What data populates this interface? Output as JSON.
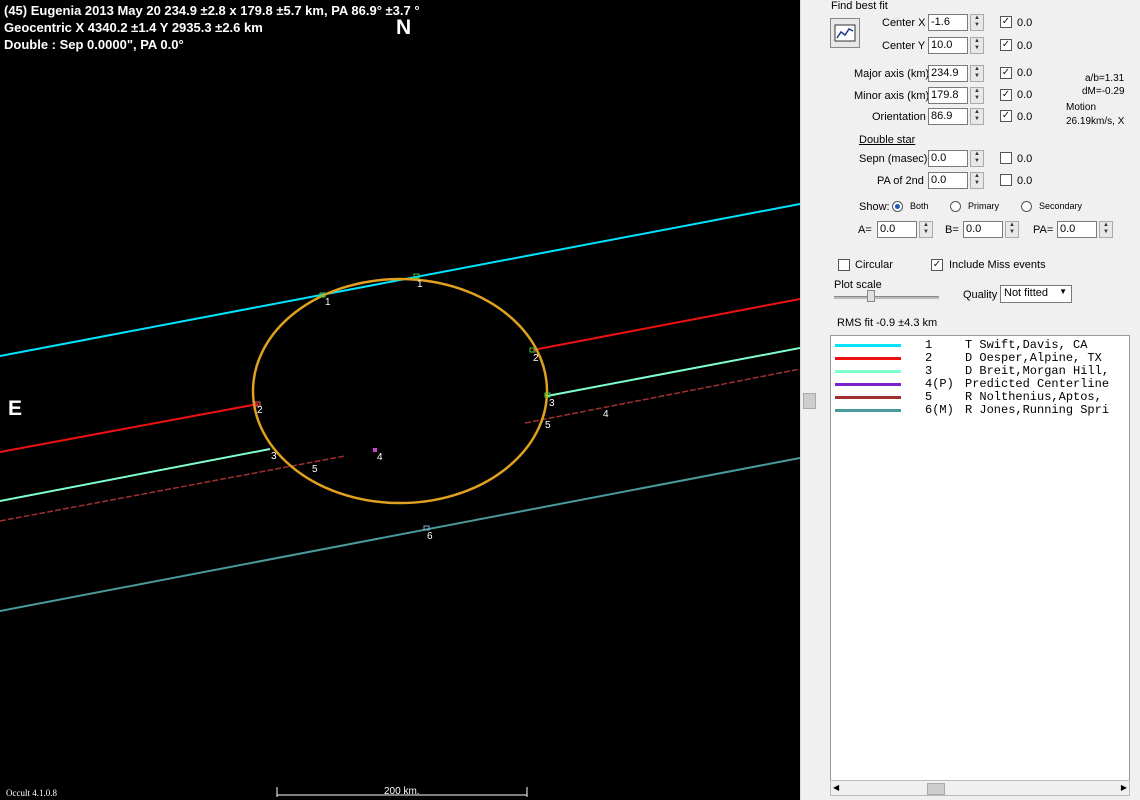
{
  "plot": {
    "header_line1": "(45) Eugenia  2013 May 20   234.9 ±2.8 x 179.8 ±5.7 km,  PA 86.9° ±3.7 °",
    "header_line2": "Geocentric  X  4340.2 ±1.4   Y 2935.3 ±2.6 km",
    "header_line3": "Double : Sep  0.0000\", PA 0.0°",
    "north": "N",
    "east": "E",
    "version": "Occult 4.1.0.8",
    "scale_label": "200 km.",
    "chord_labels": [
      "1",
      "1",
      "2",
      "2",
      "3",
      "3",
      "4",
      "4",
      "5",
      "5",
      "6"
    ]
  },
  "panel": {
    "find_best_fit": "Find best fit",
    "center_x_label": "Center X",
    "center_x_value": "-1.6",
    "center_x_unc": "0.0",
    "center_y_label": "Center Y",
    "center_y_value": "10.0",
    "center_y_unc": "0.0",
    "major_label": "Major axis (km)",
    "major_value": "234.9",
    "major_unc": "0.0",
    "minor_label": "Minor axis (km)",
    "minor_value": "179.8",
    "minor_unc": "0.0",
    "orient_label": "Orientation",
    "orient_value": "86.9",
    "orient_unc": "0.0",
    "ab_ratio": "a/b=1.31",
    "dm": "dM=-0.29",
    "motion_label": "Motion",
    "motion_value": "26.19km/s, X",
    "double_star": "Double star",
    "sepn_label": "Sepn (masec)",
    "sepn_value": "0.0",
    "sepn_unc": "0.0",
    "pa2_label": "PA of 2nd",
    "pa2_value": "0.0",
    "pa2_unc": "0.0",
    "show_label": "Show:",
    "show_both": "Both",
    "show_primary": "Primary",
    "show_secondary": "Secondary",
    "a_label": "A=",
    "a_value": "0.0",
    "b_label": "B=",
    "b_value": "0.0",
    "pa_label": "PA=",
    "pa_value": "0.0",
    "circular": "Circular",
    "include_miss": "Include Miss events",
    "plot_scale": "Plot scale",
    "quality_label": "Quality",
    "quality_value": "Not fitted",
    "rms_fit": "RMS fit -0.9 ±4.3 km"
  },
  "legend": [
    {
      "index": "1",
      "name": "T Swift,Davis, CA",
      "color": "#00e5ff"
    },
    {
      "index": "2",
      "name": "D Oesper,Alpine, TX",
      "color": "#ee1111"
    },
    {
      "index": "3",
      "name": "D Breit,Morgan Hill,",
      "color": "#80ffcc"
    },
    {
      "index": "4(P)",
      "name": "Predicted Centerline",
      "color": "#7722cc"
    },
    {
      "index": "5",
      "name": "R Nolthenius,Aptos,",
      "color": "#a03030"
    },
    {
      "index": "6(M)",
      "name": "R Jones,Running Spri",
      "color": "#4a9a9a"
    }
  ],
  "colors": {
    "ellipse": "#e0a020",
    "chord1": "#00e5ff",
    "chord2": "#ee1111",
    "chord3": "#80ffcc",
    "chord5": "#a03030",
    "chord6": "#4a9a9a",
    "predicted": "#cc44cc"
  }
}
